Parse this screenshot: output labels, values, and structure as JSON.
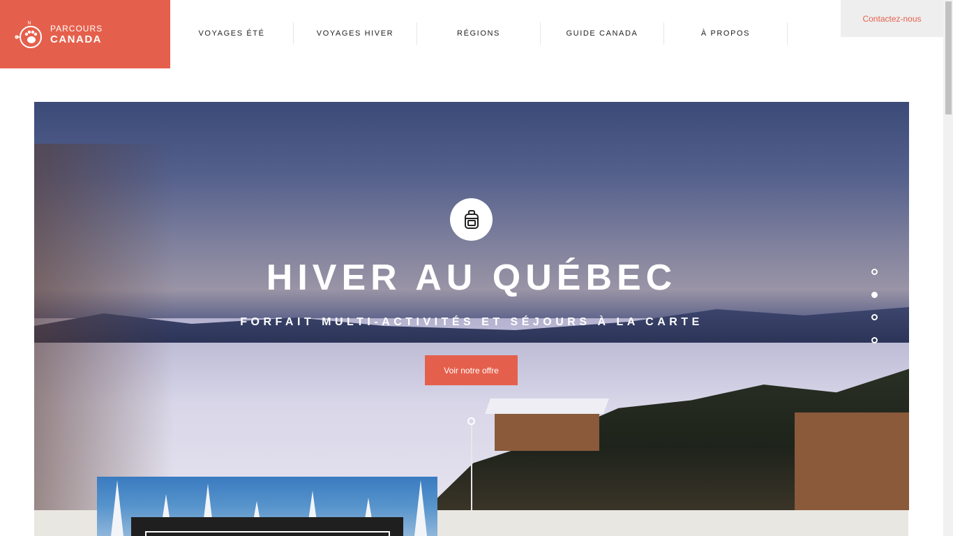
{
  "logo": {
    "line1": "PARCOURS",
    "line2": "CANADA",
    "compass_letter": "N",
    "icon": "bear-paw-compass-icon"
  },
  "nav": [
    {
      "label": "VOYAGES ÉTÉ"
    },
    {
      "label": "VOYAGES HIVER"
    },
    {
      "label": "RÉGIONS"
    },
    {
      "label": "GUIDE CANADA"
    },
    {
      "label": "À PROPOS"
    }
  ],
  "contact": {
    "label": "Contactez-nous"
  },
  "hero": {
    "icon": "backpack-icon",
    "title": "HIVER AU QUÉBEC",
    "subtitle": "FORFAIT MULTI-ACTIVITÉS ET SÉJOURS À LA CARTE",
    "cta": "Voir notre offre",
    "slides_total": 4,
    "active_slide": 2
  },
  "colors": {
    "brand": "#e5604c",
    "contact_bg": "#eeeeee",
    "band": "#e9e7e1"
  }
}
